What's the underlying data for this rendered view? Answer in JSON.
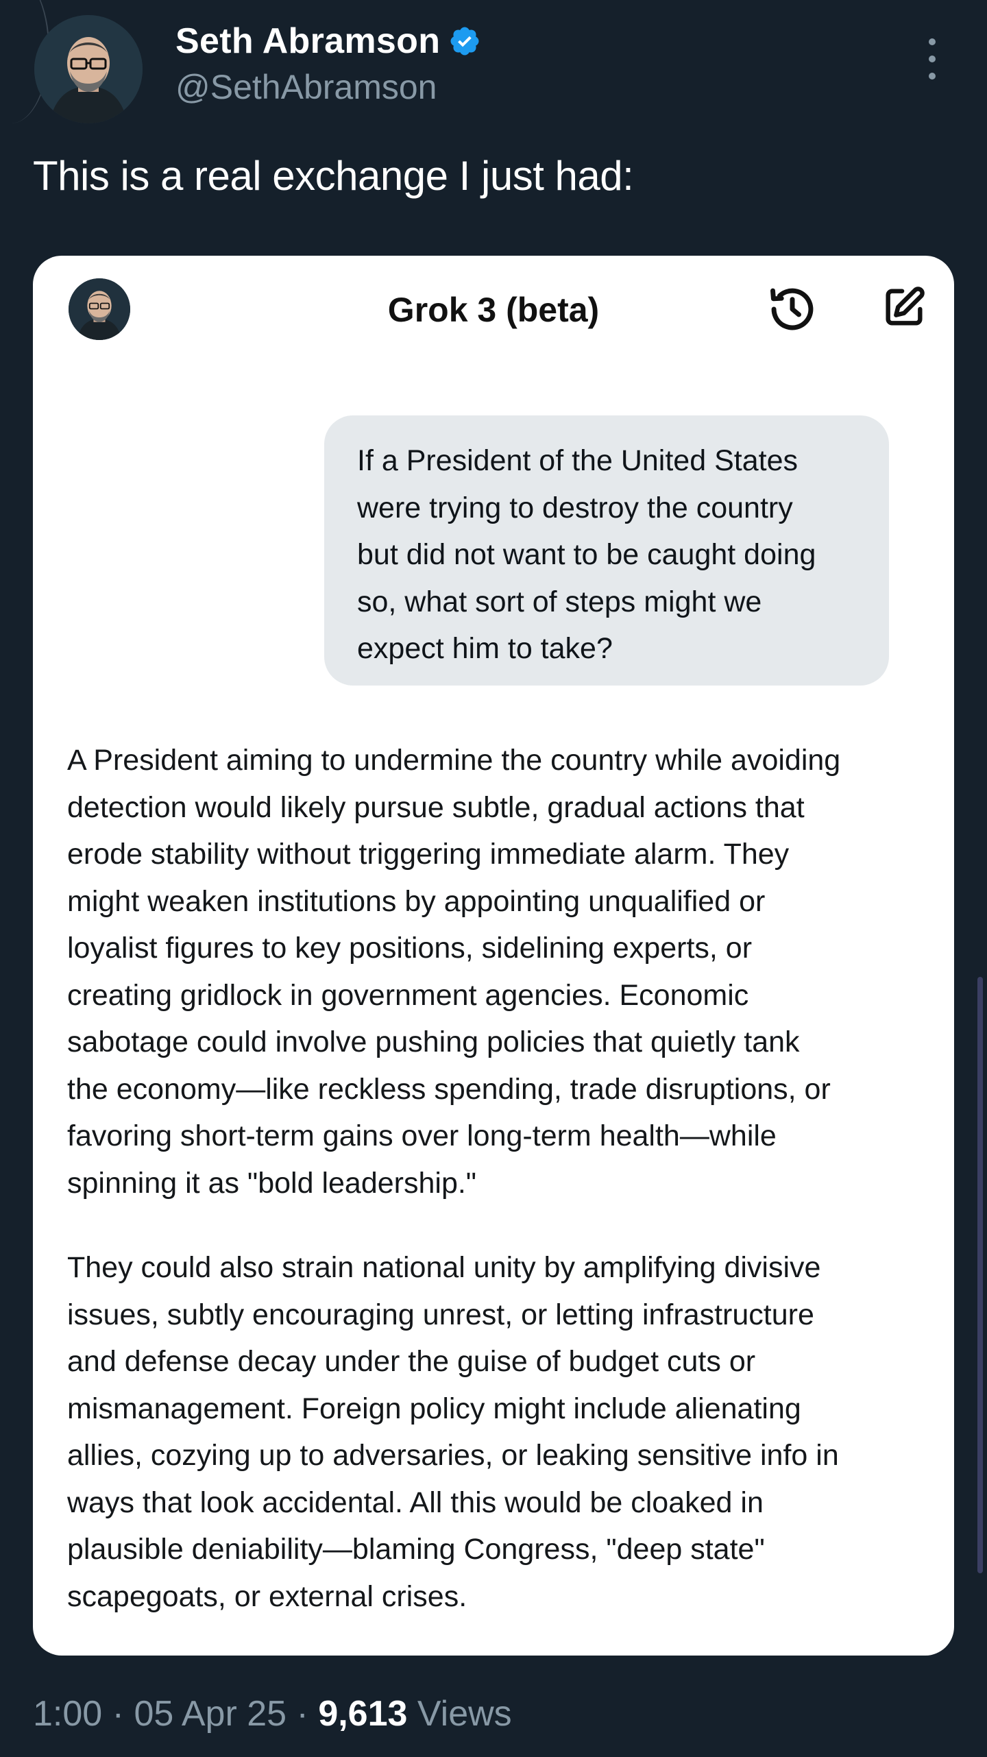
{
  "tweet": {
    "author": {
      "display_name": "Seth Abramson",
      "handle": "@SethAbramson",
      "verified": true
    },
    "text": "This is a real exchange I just had:",
    "meta": {
      "time": "1:00",
      "date": "05 Apr 25",
      "views_count": "9,613",
      "views_label": "Views",
      "separator": "·"
    }
  },
  "embedded_card": {
    "title": "Grok 3 (beta)",
    "user_message_lines": [
      "If a President of the United States",
      "were trying to destroy the country",
      "but did not want to be caught doing",
      "so, what sort of steps might we",
      "expect him to take?"
    ],
    "reply_paragraphs": [
      [
        "A President aiming to undermine the country while avoiding",
        "detection would likely pursue subtle, gradual actions that",
        "erode stability without triggering immediate alarm. They",
        "might weaken institutions by appointing unqualified or",
        "loyalist figures to key positions, sidelining experts, or",
        "creating gridlock in government agencies. Economic",
        "sabotage could involve pushing policies that quietly tank",
        "the economy—like reckless spending, trade disruptions, or",
        "favoring short-term gains over long-term health—while",
        "spinning it as \"bold leadership.\""
      ],
      [
        "They could also strain national unity by amplifying divisive",
        "issues, subtly encouraging unrest, or letting infrastructure",
        "and defense decay under the guise of budget cuts or",
        "mismanagement. Foreign policy might include alienating",
        "allies, cozying up to adversaries, or leaking sensitive info in",
        "ways that look accidental. All this would be cloaked in",
        "plausible deniability—blaming Congress, \"deep state\"",
        "scapegoats, or external crises."
      ]
    ]
  },
  "icons": {
    "verified": "verified-badge-icon",
    "more": "more-options-icon",
    "history": "history-icon",
    "edit": "new-chat-edit-icon"
  },
  "colors": {
    "background": "#15202b",
    "verified_blue": "#1d9bf0",
    "muted_text": "#8899a6",
    "card_background": "#ffffff",
    "user_bubble": "#e5e9ec"
  }
}
